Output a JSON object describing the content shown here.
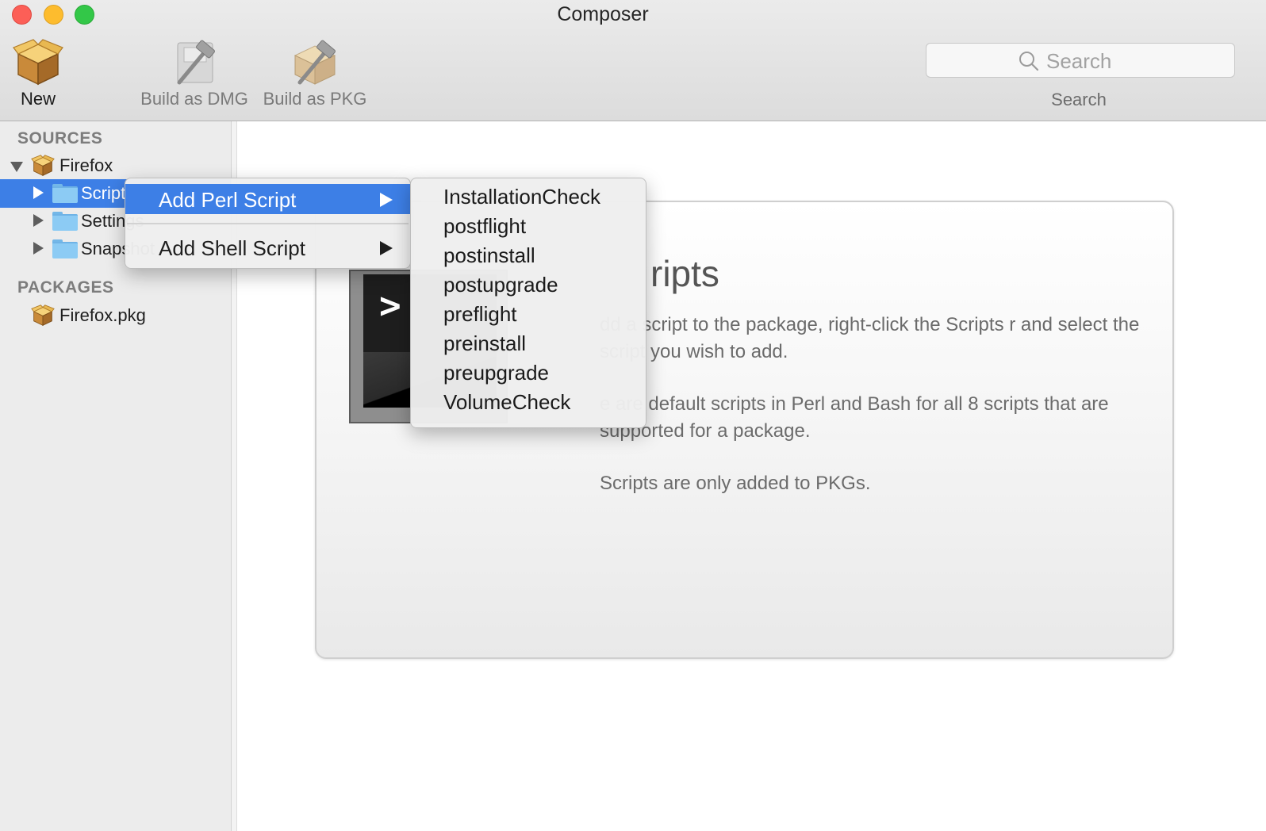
{
  "window": {
    "title": "Composer"
  },
  "toolbar": {
    "new_label": "New",
    "build_dmg_label": "Build as DMG",
    "build_pkg_label": "Build as PKG",
    "search_placeholder": "Search",
    "search_caption": "Search"
  },
  "sidebar": {
    "sources_header": "SOURCES",
    "source_root": "Firefox",
    "source_children": [
      "Scripts",
      "Settings",
      "Snapshot"
    ],
    "packages_header": "PACKAGES",
    "packages": [
      "Firefox.pkg"
    ]
  },
  "context_menu": {
    "items": [
      {
        "label": "Add Perl Script",
        "highlighted": true
      },
      {
        "label": "Add Shell Script",
        "highlighted": false
      }
    ],
    "submenu": [
      "InstallationCheck",
      "postflight",
      "postinstall",
      "postupgrade",
      "preflight",
      "preinstall",
      "preupgrade",
      "VolumeCheck"
    ]
  },
  "panel": {
    "title_visible": "ripts",
    "terminal_prompt": ">",
    "para1": "dd a script to the package, right-click the Scripts r and select the script you wish to add.",
    "para2": "e are default scripts in Perl and Bash for all 8 scripts that are supported for a package.",
    "para3": "Scripts are only added to PKGs."
  },
  "colors": {
    "selection": "#3d7fe6",
    "close": "#fc5f57",
    "minimize": "#fdbc2e",
    "zoom": "#33c748"
  },
  "icons": {
    "new": "package-box-icon",
    "build_dmg": "hammer-disk-icon",
    "build_pkg": "hammer-box-icon",
    "search": "magnifier-icon",
    "folder": "folder-icon",
    "package": "package-box-icon",
    "terminal": "terminal-icon"
  }
}
